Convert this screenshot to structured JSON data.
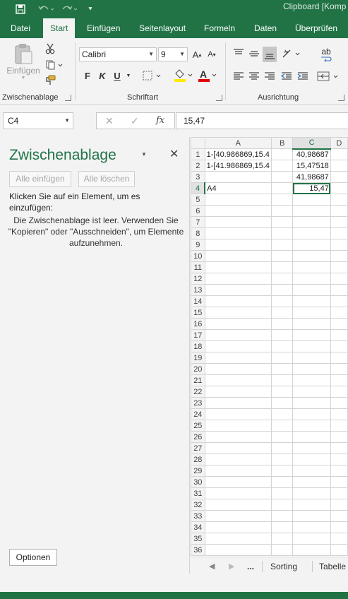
{
  "titlebar": {
    "title": "Clipboard  [Komp",
    "save_icon": "save-icon",
    "undo_icon": "undo-icon",
    "redo_icon": "redo-icon",
    "customize_icon": "customize-quick-access-icon"
  },
  "ribbon_tabs": [
    "Datei",
    "Start",
    "Einfügen",
    "Seitenlayout",
    "Formeln",
    "Daten",
    "Überprüfen"
  ],
  "active_tab": "Start",
  "ribbon": {
    "clipboard_group": {
      "paste_label": "Einfügen",
      "label": "Zwischenablage"
    },
    "font_group": {
      "font_name": "Calibri",
      "font_size": "9",
      "bold": "F",
      "italic": "K",
      "underline": "U",
      "grow_font": "A",
      "shrink_font": "A",
      "font_color_letter": "A",
      "label": "Schriftart"
    },
    "alignment_group": {
      "label": "Ausrichtung",
      "wrap_text": "ab"
    }
  },
  "formula_bar": {
    "name_box": "C4",
    "formula": "15,47",
    "cancel_icon": "✕",
    "enter_icon": "✓",
    "fx_label": "fx"
  },
  "clipboard_pane": {
    "title": "Zwischenablage",
    "paste_all": "Alle einfügen",
    "clear_all": "Alle löschen",
    "instructions": "Klicken Sie auf ein Element, um es einzufügen:",
    "empty_message": "Die Zwischenablage ist leer. Verwenden Sie \"Kopieren\" oder \"Ausschneiden\", um Elemente aufzunehmen.",
    "options": "Optionen"
  },
  "grid": {
    "columns": [
      "A",
      "B",
      "C",
      "D"
    ],
    "selected_column": "C",
    "selected_row": 4,
    "active_cell": "C4",
    "rows": [
      {
        "n": 1,
        "a": "1-[40.986869,15.4",
        "b": "",
        "c": "40,98687"
      },
      {
        "n": 2,
        "a": "1-[41.986869,15.4",
        "b": "",
        "c": "15,47518"
      },
      {
        "n": 3,
        "a": "",
        "b": "",
        "c": "41,98687"
      },
      {
        "n": 4,
        "a": "A4",
        "b": "",
        "c": "15,47"
      },
      {
        "n": 5,
        "a": "",
        "b": "",
        "c": ""
      },
      {
        "n": 6,
        "a": "",
        "b": "",
        "c": ""
      },
      {
        "n": 7,
        "a": "",
        "b": "",
        "c": ""
      },
      {
        "n": 8,
        "a": "",
        "b": "",
        "c": ""
      },
      {
        "n": 9,
        "a": "",
        "b": "",
        "c": ""
      },
      {
        "n": 10,
        "a": "",
        "b": "",
        "c": ""
      },
      {
        "n": 11,
        "a": "",
        "b": "",
        "c": ""
      },
      {
        "n": 12,
        "a": "",
        "b": "",
        "c": ""
      },
      {
        "n": 13,
        "a": "",
        "b": "",
        "c": ""
      },
      {
        "n": 14,
        "a": "",
        "b": "",
        "c": ""
      },
      {
        "n": 15,
        "a": "",
        "b": "",
        "c": ""
      },
      {
        "n": 16,
        "a": "",
        "b": "",
        "c": ""
      },
      {
        "n": 17,
        "a": "",
        "b": "",
        "c": ""
      },
      {
        "n": 18,
        "a": "",
        "b": "",
        "c": ""
      },
      {
        "n": 19,
        "a": "",
        "b": "",
        "c": ""
      },
      {
        "n": 20,
        "a": "",
        "b": "",
        "c": ""
      },
      {
        "n": 21,
        "a": "",
        "b": "",
        "c": ""
      },
      {
        "n": 22,
        "a": "",
        "b": "",
        "c": ""
      },
      {
        "n": 23,
        "a": "",
        "b": "",
        "c": ""
      },
      {
        "n": 24,
        "a": "",
        "b": "",
        "c": ""
      },
      {
        "n": 25,
        "a": "",
        "b": "",
        "c": ""
      },
      {
        "n": 26,
        "a": "",
        "b": "",
        "c": ""
      },
      {
        "n": 27,
        "a": "",
        "b": "",
        "c": ""
      },
      {
        "n": 28,
        "a": "",
        "b": "",
        "c": ""
      },
      {
        "n": 29,
        "a": "",
        "b": "",
        "c": ""
      },
      {
        "n": 30,
        "a": "",
        "b": "",
        "c": ""
      },
      {
        "n": 31,
        "a": "",
        "b": "",
        "c": ""
      },
      {
        "n": 32,
        "a": "",
        "b": "",
        "c": ""
      },
      {
        "n": 33,
        "a": "",
        "b": "",
        "c": ""
      },
      {
        "n": 34,
        "a": "",
        "b": "",
        "c": ""
      },
      {
        "n": 35,
        "a": "",
        "b": "",
        "c": ""
      },
      {
        "n": 36,
        "a": "",
        "b": "",
        "c": ""
      }
    ]
  },
  "sheet_tabs": {
    "prev": "◀",
    "next": "▶",
    "more": "...",
    "tabs": [
      "Sorting",
      "Tabelle"
    ]
  },
  "colors": {
    "accent": "#217346",
    "ribbon_bg": "#f3f3f3",
    "grid_line": "#d4d4d4"
  }
}
